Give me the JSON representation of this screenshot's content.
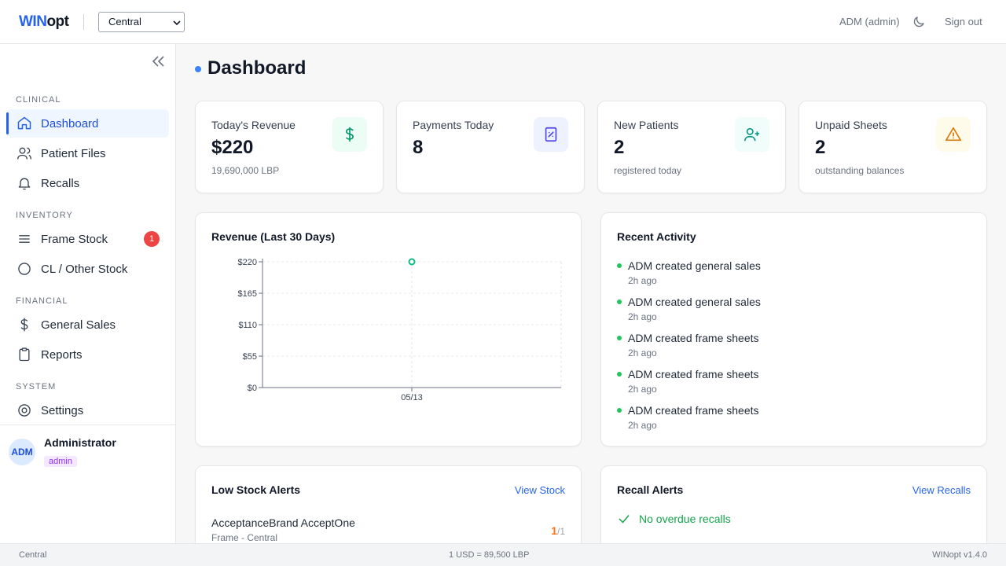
{
  "app": {
    "logo_part1": "WIN",
    "logo_part2": "opt",
    "branch": "Central",
    "user": "ADM (admin)",
    "signout": "Sign out"
  },
  "sidebar": {
    "sections": {
      "clinical": "CLINICAL",
      "inventory": "INVENTORY",
      "financial": "FINANCIAL",
      "system": "SYSTEM"
    },
    "items": [
      {
        "label": "Dashboard",
        "icon": "home-icon",
        "active": true
      },
      {
        "label": "Patient Files",
        "icon": "users-icon"
      },
      {
        "label": "Recalls",
        "icon": "bell-icon"
      },
      {
        "label": "Frame Stock",
        "icon": "menu-icon",
        "badge": "1"
      },
      {
        "label": "CL / Other Stock",
        "icon": "circle-icon"
      },
      {
        "label": "General Sales",
        "icon": "dollar-icon"
      },
      {
        "label": "Reports",
        "icon": "clipboard-icon"
      },
      {
        "label": "Settings",
        "icon": "settings-icon"
      }
    ],
    "user": {
      "initials": "ADM",
      "name": "Administrator",
      "role": "admin"
    }
  },
  "main": {
    "title": "Dashboard",
    "stats": [
      {
        "label": "Today's Revenue",
        "value": "$220",
        "sub": "19,690,000 LBP",
        "icon": "dollar-icon",
        "color": "#059669",
        "bg": "#ecfdf5"
      },
      {
        "label": "Payments Today",
        "value": "8",
        "sub": "",
        "icon": "receipt-icon",
        "color": "#4f46e5",
        "bg": "#eef2ff"
      },
      {
        "label": "New Patients",
        "value": "2",
        "sub": "registered today",
        "icon": "user-plus-icon",
        "color": "#0d9488",
        "bg": "#f0fdfa"
      },
      {
        "label": "Unpaid Sheets",
        "value": "2",
        "sub": "outstanding balances",
        "icon": "warning-icon",
        "color": "#d97706",
        "bg": "#fffbeb"
      }
    ],
    "revenue_card": {
      "title": "Revenue (Last 30 Days)"
    },
    "activity": {
      "title": "Recent Activity",
      "items": [
        {
          "text": "ADM created general sales",
          "when": "2h ago"
        },
        {
          "text": "ADM created general sales",
          "when": "2h ago"
        },
        {
          "text": "ADM created frame sheets",
          "when": "2h ago"
        },
        {
          "text": "ADM created frame sheets",
          "when": "2h ago"
        },
        {
          "text": "ADM created frame sheets",
          "when": "2h ago"
        }
      ]
    },
    "low_stock": {
      "title": "Low Stock Alerts",
      "link": "View Stock",
      "items": [
        {
          "name": "AcceptanceBrand AcceptOne",
          "sub": "Frame - Central",
          "qty": "1",
          "min": "/1"
        }
      ]
    },
    "recall": {
      "title": "Recall Alerts",
      "link": "View Recalls",
      "empty": "No overdue recalls"
    }
  },
  "footer": {
    "branch": "Central",
    "rate": "1 USD = 89,500 LBP",
    "version": "WINopt v1.4.0"
  },
  "chart_data": {
    "type": "line",
    "title": "Revenue (Last 30 Days)",
    "x": [
      "05/13"
    ],
    "series": [
      {
        "values": [
          220
        ]
      }
    ],
    "yticks": [
      "$0",
      "$55",
      "$110",
      "$165",
      "$220"
    ],
    "ylim": [
      0,
      220
    ],
    "grid": true,
    "color": "#10b981"
  }
}
